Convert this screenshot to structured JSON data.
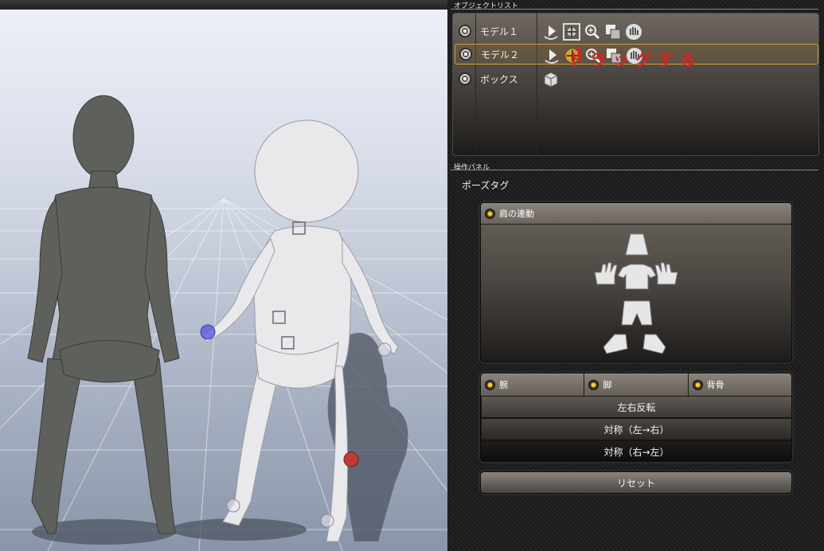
{
  "object_list": {
    "title": "オブジェクトリスト",
    "items": [
      {
        "name": "モデル１",
        "selected": false,
        "tools": [
          "pose-play-icon",
          "move-gizmo-icon",
          "zoom-icon",
          "copy-icon",
          "hand-icon"
        ]
      },
      {
        "name": "モデル２",
        "selected": true,
        "tools": [
          "pose-play-icon",
          "move-gizmo-icon",
          "zoom-icon",
          "copy-icon",
          "hand-icon"
        ]
      },
      {
        "name": "ボックス",
        "selected": false,
        "tools": [
          "cube-icon"
        ]
      }
    ],
    "drag_hint": "ドラッグする",
    "drag_arrow": "↑"
  },
  "operation_panel": {
    "title": "操作パネル",
    "pose_tag_label": "ポーズタグ",
    "shoulder_link_label": "肩の連動",
    "body_parts": [
      "head-icon",
      "left-hand-icon",
      "shirt-icon",
      "right-hand-icon",
      "shorts-icon",
      "shoes-icon"
    ],
    "tabs": [
      "腕",
      "脚",
      "背骨"
    ],
    "buttons": {
      "mirror": "左右反転",
      "sym_left_to_right": "対称（左→右）",
      "sym_right_to_left": "対称（右→左）",
      "reset": "リセット"
    }
  },
  "viewport": {
    "figures": [
      "dark-female-model",
      "white-child-model"
    ],
    "joint_colors": {
      "selected": "#5a5ad8",
      "marker_red": "#c23a3a",
      "joint_white": "#e8e8ee"
    }
  }
}
